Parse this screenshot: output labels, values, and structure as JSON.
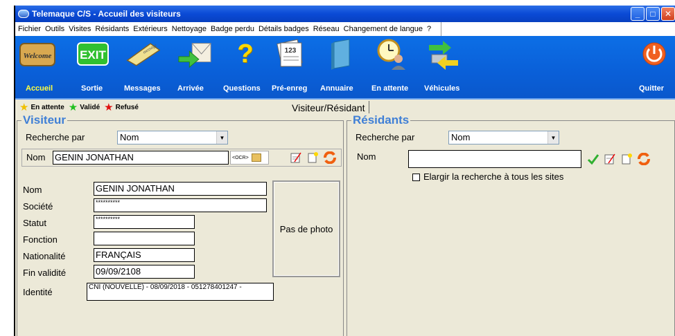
{
  "window": {
    "title": "Telemaque C/S  - Accueil des visiteurs"
  },
  "menu": [
    "Fichier",
    "Outils",
    "Visites",
    "Résidants",
    "Extérieurs",
    "Nettoyage",
    "Badge perdu",
    "Détails badges",
    "Réseau",
    "Changement de langue",
    "?"
  ],
  "toolbar": {
    "accueil": "Accueil",
    "sortie": "Sortie",
    "messages": "Messages",
    "arrivee": "Arrivée",
    "questions": "Questions",
    "preenreg": "Pré-enreg",
    "annuaire": "Annuaire",
    "enattente": "En attente",
    "vehicules": "Véhicules",
    "quitter": "Quitter",
    "welcome_text": "Welcome",
    "exit_text": "EXIT",
    "message_text": "message"
  },
  "legend": {
    "attente": "En attente",
    "valide": "Validé",
    "refuse": "Refusé"
  },
  "tab": {
    "label": "Visiteur/Résidant"
  },
  "visiteur": {
    "title": "Visiteur",
    "recherche_label": "Recherche par",
    "recherche_value": "Nom",
    "nom_label": "Nom",
    "nom_value": "GENIN JONATHAN",
    "ocr": "<OCR>",
    "fields": {
      "nom_label": "Nom",
      "nom_value": "GENIN JONATHAN",
      "societe_label": "Société",
      "societe_value": "**********",
      "statut_label": "Statut",
      "statut_value": "**********",
      "fonction_label": "Fonction",
      "fonction_value": "",
      "nationalite_label": "Nationalité",
      "nationalite_value": "FRANÇAIS",
      "fin_label": "Fin validité",
      "fin_value": "09/09/2108",
      "identite_label": "Identité",
      "identite_value": "CNI (NOUVELLE) - 08/09/2018 - 051278401247 -"
    },
    "photo": "Pas de photo"
  },
  "residants": {
    "title": "Résidants",
    "recherche_label": "Recherche par",
    "recherche_value": "Nom",
    "nom_label": "Nom",
    "nom_value": "",
    "elargir": "Elargir la recherche à tous les sites"
  },
  "colors": {
    "titlebar": "#0a4ad6",
    "toolbar": "#0a5fd8",
    "accent": "#3f7fd6",
    "star_yellow": "#f0c000",
    "star_green": "#20c020",
    "star_red": "#e01010"
  }
}
